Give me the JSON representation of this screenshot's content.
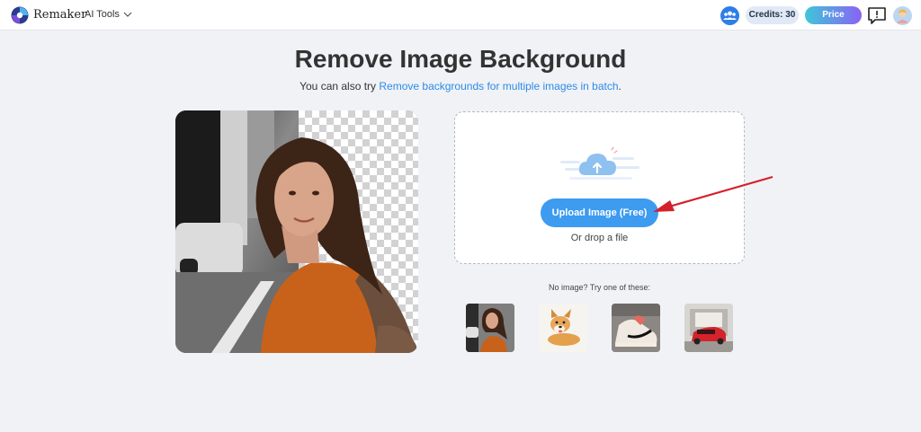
{
  "header": {
    "brand": "Remaker",
    "tools_label": "AI Tools",
    "credits_label": "Credits: 30",
    "price_label": "Price"
  },
  "main": {
    "title": "Remove Image Background",
    "subtitle_prefix": "You can also try ",
    "subtitle_link": "Remove backgrounds for multiple images in batch",
    "subtitle_suffix": "."
  },
  "upload": {
    "button_label": "Upload Image (Free)",
    "drop_label": "Or drop a file"
  },
  "samples": {
    "prompt": "No image? Try one of these:",
    "items": [
      "woman-photo",
      "dog-photo",
      "sneaker-photo",
      "car-photo"
    ]
  },
  "colors": {
    "accent": "#3d9bf0",
    "link": "#2b8be8",
    "arrow": "#d4202a",
    "price_gradient_start": "#3ec6d8",
    "price_gradient_end": "#8a62f5"
  }
}
